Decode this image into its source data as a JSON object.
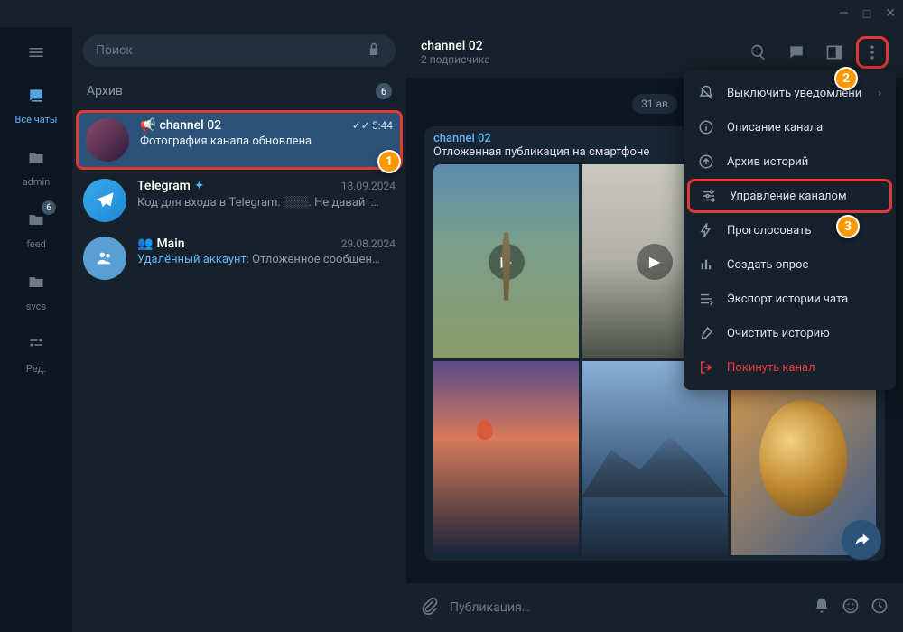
{
  "titlebar": {
    "min": "—",
    "max": "□",
    "close": "✕"
  },
  "rail": {
    "items": [
      {
        "label": "Все чаты",
        "icon": "chats"
      },
      {
        "label": "admin",
        "icon": "folder"
      },
      {
        "label": "feed",
        "icon": "folder",
        "badge": "6"
      },
      {
        "label": "svcs",
        "icon": "folder"
      },
      {
        "label": "Ред.",
        "icon": "edit"
      }
    ]
  },
  "search": {
    "placeholder": "Поиск"
  },
  "archive": {
    "label": "Архив",
    "badge": "6"
  },
  "chats": [
    {
      "name": "channel 02",
      "icon": "📢",
      "time": "5:44",
      "checks": "✓✓",
      "preview": "Фотография канала обновлена"
    },
    {
      "name": "Telegram",
      "verified": true,
      "time": "18.09.2024",
      "preview": "Код для входа в Telegram: ░░░. Не давайт…"
    },
    {
      "name": "Main",
      "icon": "👥",
      "time": "29.08.2024",
      "preview_a": "Удалённый аккаунт:",
      "preview_b": " Отложенное сообщен…"
    }
  ],
  "header": {
    "title": "channel 02",
    "subtitle": "2 подписчика"
  },
  "date_chip": "31 ав",
  "message": {
    "from": "channel 02",
    "text": "Отложенная публикация на смартфоне"
  },
  "composer": {
    "placeholder": "Публикация…"
  },
  "dropdown": [
    {
      "label": "Выключить уведомлени",
      "icon": "mute",
      "chevron": true
    },
    {
      "label": "Описание канала",
      "icon": "info"
    },
    {
      "label": "Архив историй",
      "icon": "archive"
    },
    {
      "label": "Управление каналом",
      "icon": "manage",
      "highlighted": true
    },
    {
      "label": "Проголосовать",
      "icon": "bolt"
    },
    {
      "label": "Создать опрос",
      "icon": "poll"
    },
    {
      "label": "Экспорт истории чата",
      "icon": "export"
    },
    {
      "label": "Очистить историю",
      "icon": "clear"
    },
    {
      "label": "Покинуть канал",
      "icon": "leave",
      "danger": true
    }
  ],
  "callouts": {
    "c1": "1",
    "c2": "2",
    "c3": "3"
  }
}
